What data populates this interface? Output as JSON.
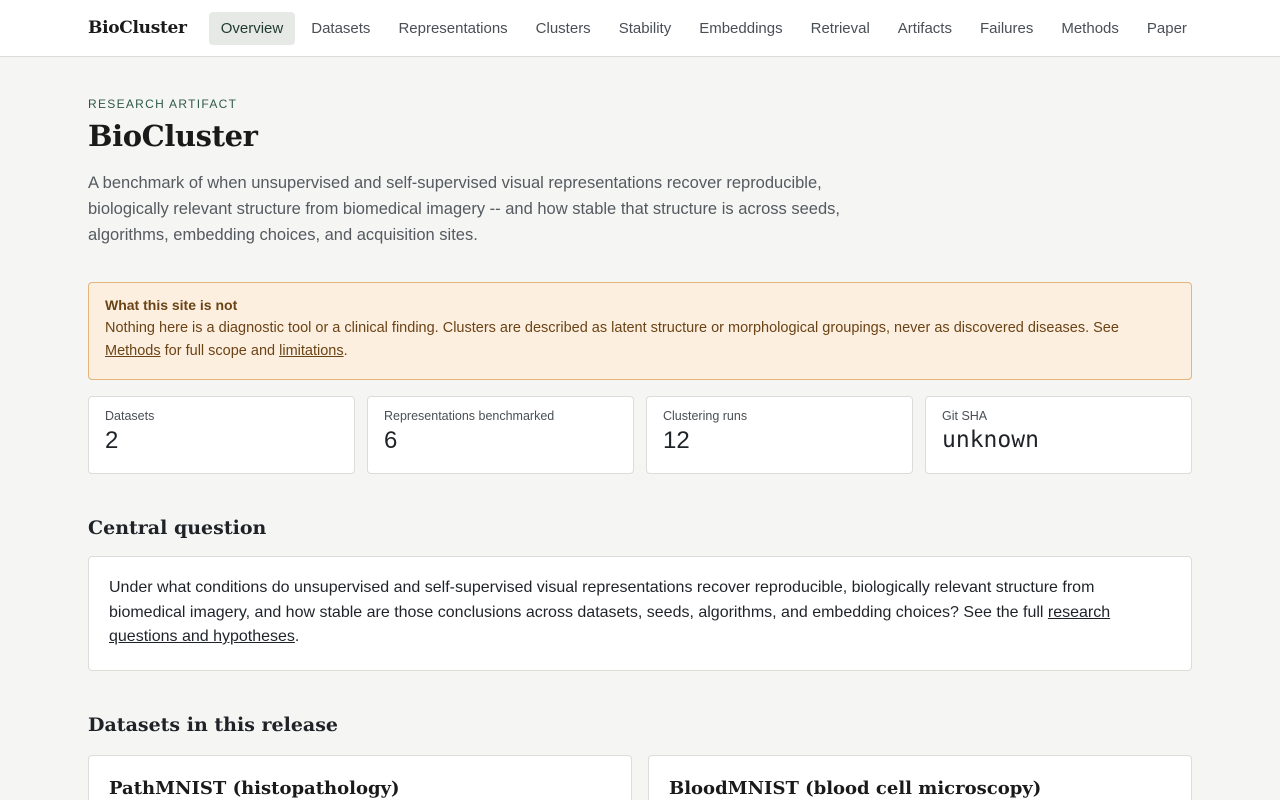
{
  "header": {
    "brand": "BioCluster",
    "nav": [
      {
        "label": "Overview",
        "active": true
      },
      {
        "label": "Datasets",
        "active": false
      },
      {
        "label": "Representations",
        "active": false
      },
      {
        "label": "Clusters",
        "active": false
      },
      {
        "label": "Stability",
        "active": false
      },
      {
        "label": "Embeddings",
        "active": false
      },
      {
        "label": "Retrieval",
        "active": false
      },
      {
        "label": "Artifacts",
        "active": false
      },
      {
        "label": "Failures",
        "active": false
      },
      {
        "label": "Methods",
        "active": false
      },
      {
        "label": "Paper",
        "active": false
      }
    ]
  },
  "hero": {
    "eyebrow": "RESEARCH ARTIFACT",
    "title": "BioCluster",
    "lead": "A benchmark of when unsupervised and self-supervised visual representations recover reproducible, biologically relevant structure from biomedical imagery -- and how stable that structure is across seeds, algorithms, embedding choices, and acquisition sites."
  },
  "notice": {
    "title": "What this site is not",
    "body_prefix": "Nothing here is a diagnostic tool or a clinical finding. Clusters are described as latent structure or morphological groupings, never as discovered diseases. See ",
    "methods_link": "Methods",
    "body_middle": " for full scope and ",
    "limitations_link": "limitations",
    "body_suffix": "."
  },
  "stats": [
    {
      "label": "Datasets",
      "value": "2"
    },
    {
      "label": "Representations benchmarked",
      "value": "6"
    },
    {
      "label": "Clustering runs",
      "value": "12"
    },
    {
      "label": "Git SHA",
      "value": "unknown"
    }
  ],
  "central": {
    "heading": "Central question",
    "body_prefix": "Under what conditions do unsupervised and self-supervised visual representations recover reproducible, biologically relevant structure from biomedical imagery, and how stable are those conclusions across datasets, seeds, algorithms, and embedding choices? See the full ",
    "link": "research questions and hypotheses",
    "body_suffix": "."
  },
  "datasets_section": {
    "heading": "Datasets in this release",
    "items": [
      {
        "title": "PathMNIST (histopathology)"
      },
      {
        "title": "BloodMNIST (blood cell microscopy)"
      }
    ]
  },
  "colors": {
    "accent": "#2f5a48",
    "notice_bg": "#fdefdf",
    "notice_border": "#e3b47c",
    "notice_text": "#6a4316"
  }
}
